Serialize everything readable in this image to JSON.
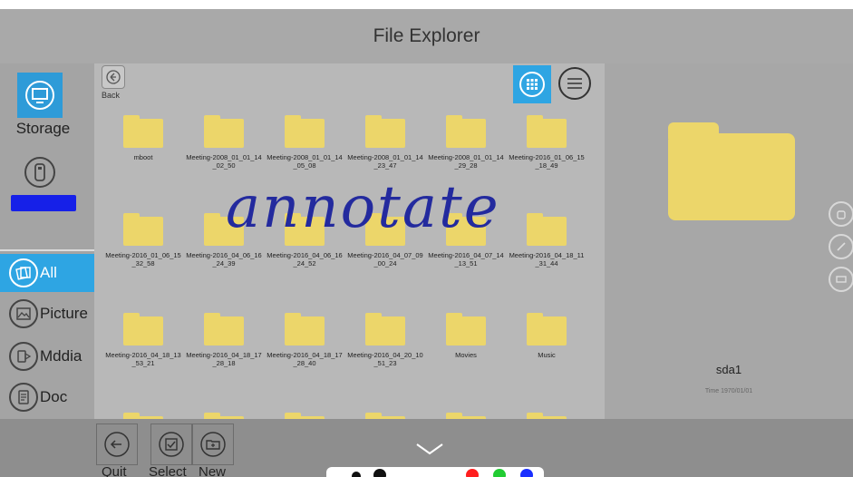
{
  "window": {
    "title": "File Explorer"
  },
  "sidebar": {
    "storage_label": "Storage",
    "categories": [
      {
        "label": "All",
        "icon": "gallery-icon",
        "active": true
      },
      {
        "label": "Picture",
        "icon": "picture-icon",
        "active": false
      },
      {
        "label": "Mddia",
        "icon": "media-icon",
        "active": false
      },
      {
        "label": "Doc",
        "icon": "document-icon",
        "active": false
      }
    ]
  },
  "toolbar": {
    "back_label": "Back"
  },
  "files": [
    "mboot",
    "Meeting-2008_01_01_14_02_50",
    "Meeting-2008_01_01_14_05_08",
    "Meeting-2008_01_01_14_23_47",
    "Meeting-2008_01_01_14_29_28",
    "Meeting-2016_01_06_15_18_49",
    "Meeting-2016_01_06_15_32_58",
    "Meeting-2016_04_06_16_24_39",
    "Meeting-2016_04_06_16_24_52",
    "Meeting-2016_04_07_09_00_24",
    "Meeting-2016_04_07_14_13_51",
    "Meeting-2016_04_18_11_31_44",
    "Meeting-2016_04_18_13_53_21",
    "Meeting-2016_04_18_17_28_18",
    "Meeting-2016_04_18_17_28_40",
    "Meeting-2016_04_20_10_51_23",
    "Movies",
    "Music"
  ],
  "annotation_text": "annotate",
  "preview": {
    "name": "sda1",
    "time": "Time 1970/01/01"
  },
  "bottom": {
    "quit_label": "Quit",
    "select_label": "Select",
    "new_label": "New"
  },
  "colors": {
    "accent": "#2ea5e3",
    "folder": "#ecd66a",
    "usb_bar": "#1620e8",
    "annotation": "#232a9e"
  },
  "pen_colors": [
    "#111111",
    "#111111",
    "#ff1f1f",
    "#22cc33",
    "#1a2fff"
  ]
}
